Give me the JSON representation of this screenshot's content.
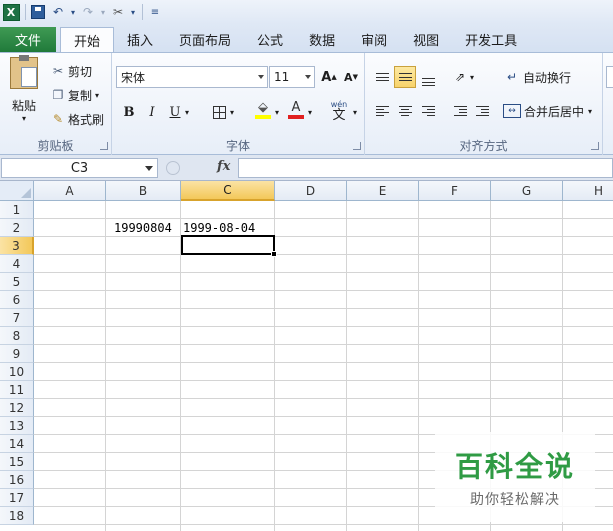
{
  "quick_access": {
    "items": [
      "X",
      "save",
      "undo",
      "redo",
      "customize"
    ]
  },
  "tabs": {
    "file": "文件",
    "items": [
      "开始",
      "插入",
      "页面布局",
      "公式",
      "数据",
      "审阅",
      "视图",
      "开发工具"
    ],
    "active": "开始"
  },
  "ribbon": {
    "clipboard": {
      "paste": "粘贴",
      "cut": "剪切",
      "copy": "复制",
      "format_painter": "格式刷",
      "label": "剪贴板"
    },
    "font": {
      "name": "宋体",
      "size": "11",
      "grow": "A",
      "shrink": "A",
      "bold": "B",
      "italic": "I",
      "underline": "U",
      "font_color": "A",
      "phonetic": "wén",
      "phonetic_char": "文",
      "label": "字体"
    },
    "alignment": {
      "wrap_text": "自动换行",
      "merge_center": "合并后居中",
      "label": "对齐方式"
    }
  },
  "formula_bar": {
    "name_box": "C3",
    "fx": "fx",
    "formula": ""
  },
  "sheet": {
    "columns": [
      "A",
      "B",
      "C",
      "D",
      "E",
      "F",
      "G",
      "H"
    ],
    "rows": [
      "1",
      "2",
      "3",
      "4",
      "5",
      "6",
      "7",
      "8",
      "9",
      "10",
      "11",
      "12",
      "13",
      "14",
      "15",
      "16",
      "17",
      "18"
    ],
    "selected_column": "C",
    "selected_row": "3",
    "cells": {
      "B2": "19990804",
      "C2": "1999-08-04"
    }
  },
  "watermark": {
    "title": "百科全说",
    "subtitle": "助你轻松解决"
  },
  "colors": {
    "file_tab": "#207a3a",
    "selection_header": "#f3c85a",
    "watermark_green": "#2f9b44"
  }
}
